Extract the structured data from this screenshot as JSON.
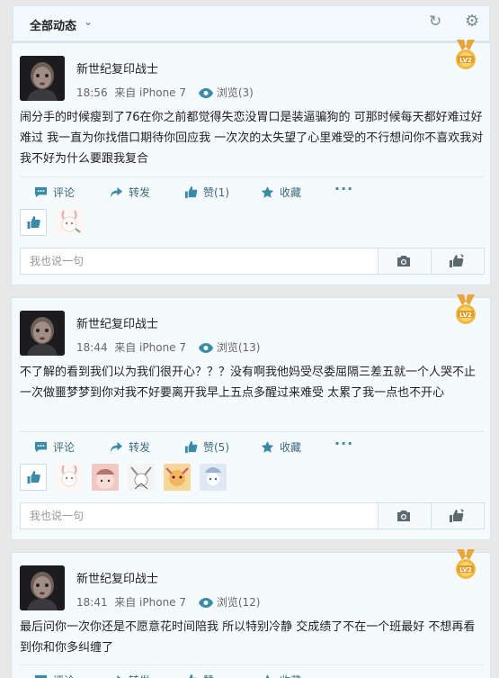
{
  "header": {
    "filter_label": "全部动态"
  },
  "comment_placeholder": "我也说一句",
  "posts": [
    {
      "username": "新世纪复印战士",
      "time": "18:56",
      "source": "来自 iPhone 7",
      "views": "浏览(3)",
      "text": "闹分手的时候瘦到了76在你之前都觉得失恋没胃口是装逼骗狗的 可那时候每天都好难过好难过 我一直为你找借口期待你回应我 一次次的太失望了心里难受的不行想问你不喜欢我对我不好为什么要跟我复合",
      "actions": {
        "comment": "评论",
        "forward": "转发",
        "like": "赞(1)",
        "favorite": "收藏"
      }
    },
    {
      "username": "新世纪复印战士",
      "time": "18:44",
      "source": "来自 iPhone 7",
      "views": "浏览(13)",
      "text": "不了解的看到我们以为我们很开心？？？没有啊我他妈受尽委屈隔三差五就一个人哭不止一次做噩梦梦到你对我不好要离开我早上五点多醒过来难受 太累了我一点也不开心",
      "actions": {
        "comment": "评论",
        "forward": "转发",
        "like": "赞(5)",
        "favorite": "收藏"
      }
    },
    {
      "username": "新世纪复印战士",
      "time": "18:41",
      "source": "来自 iPhone 7",
      "views": "浏览(12)",
      "text": "最后问你一次你还是不愿意花时间陪我 所以特别冷静 交成绩了不在一个班最好 不想再看到你和你多纠缠了",
      "actions": {
        "comment": "评论",
        "forward": "转发",
        "like": "赞",
        "favorite": "收藏"
      }
    }
  ]
}
